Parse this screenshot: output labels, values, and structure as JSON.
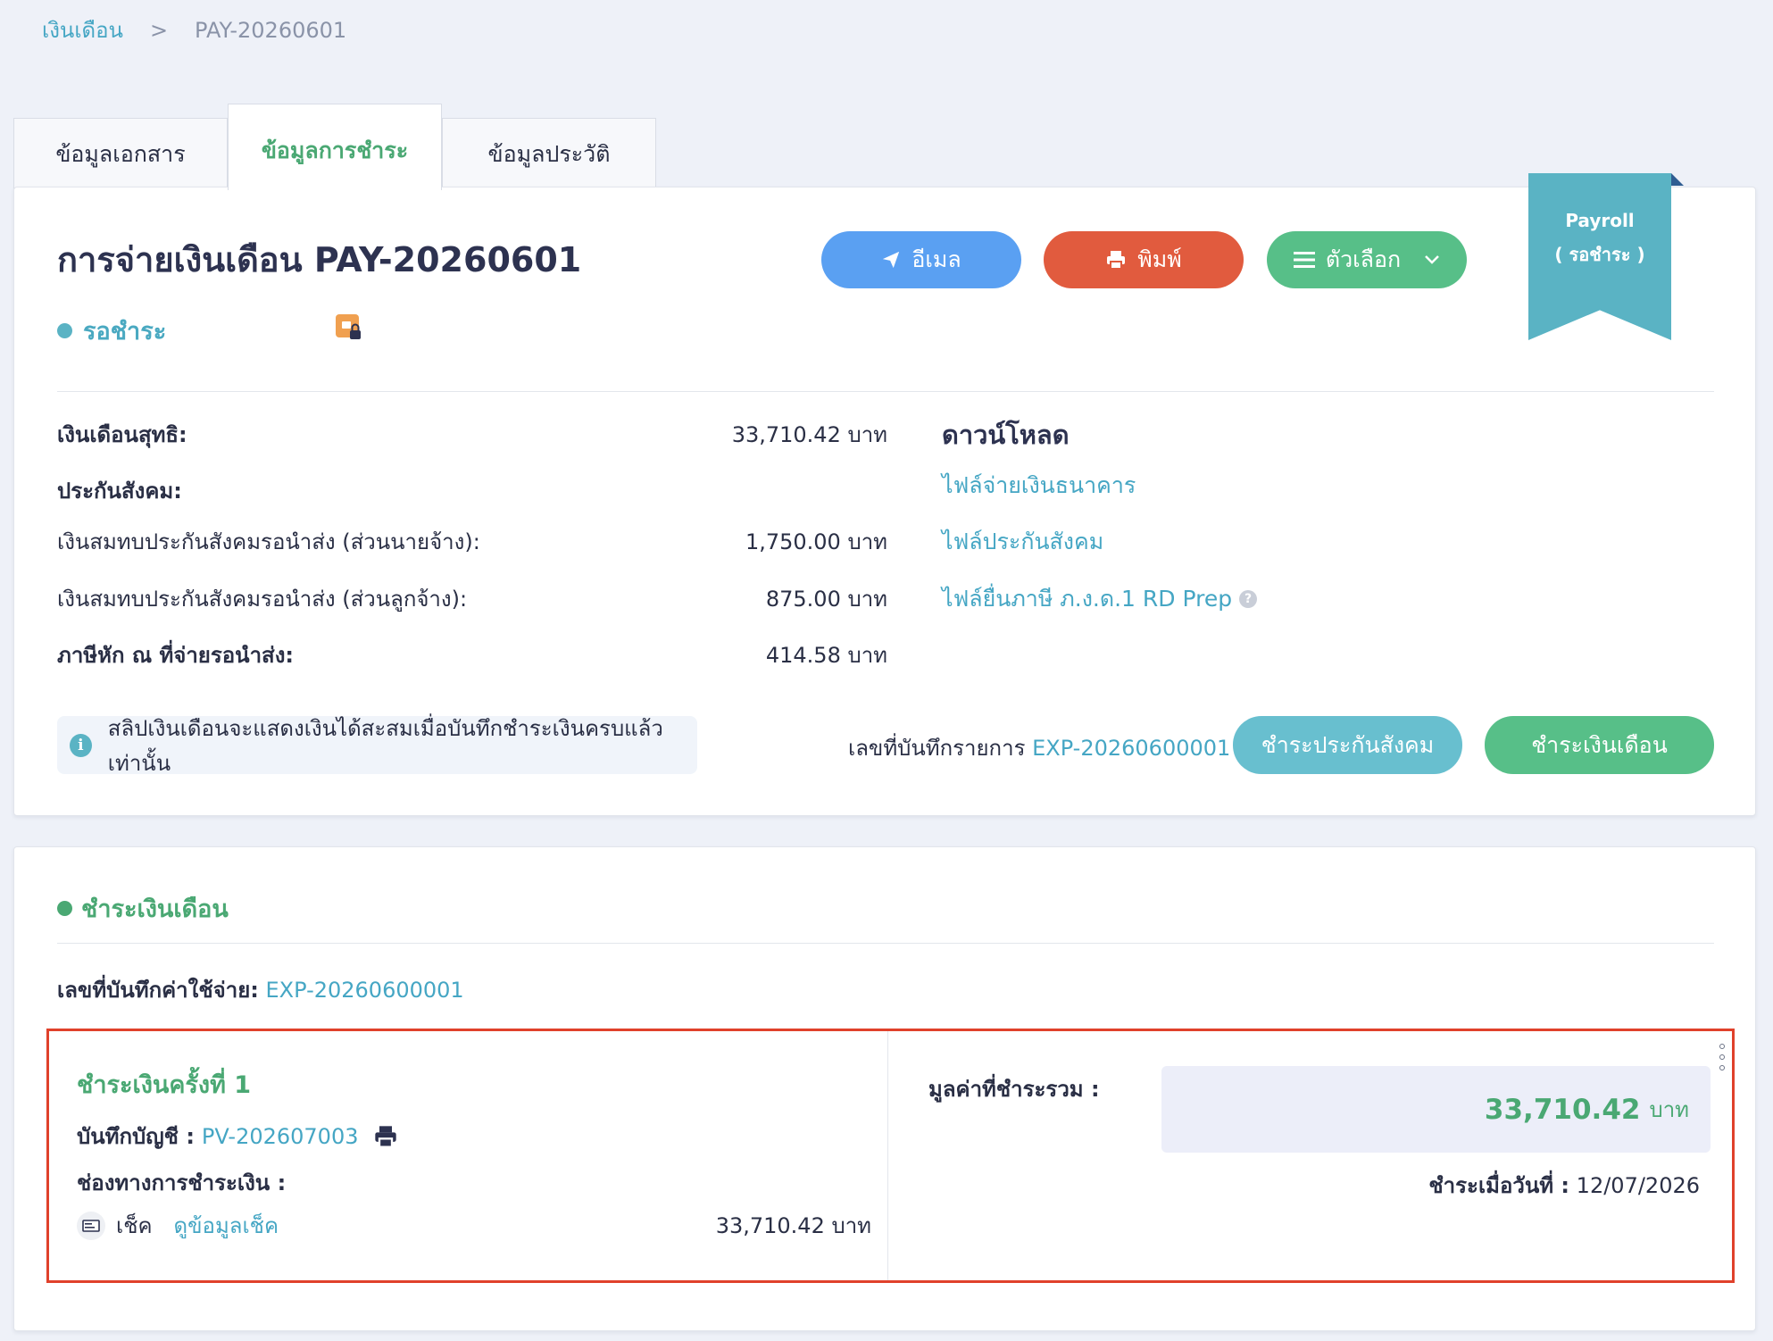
{
  "breadcrumb": {
    "parent": "เงินเดือน",
    "separator": ">",
    "current": "PAY-20260601"
  },
  "tabs": [
    {
      "label": "ข้อมูลเอกสาร"
    },
    {
      "label": "ข้อมูลการชำระ"
    },
    {
      "label": "ข้อมูลประวัติ"
    }
  ],
  "active_tab": "ข้อมูลการชำระ",
  "header": {
    "title": "การจ่ายเงินเดือน PAY-20260601",
    "status": "รอชำระ",
    "status_color": "#5ab3c4",
    "lock_icon": "locked-document-icon"
  },
  "actions": {
    "email_label": "อีเมล",
    "print_label": "พิมพ์",
    "options_label": "ตัวเลือก"
  },
  "ribbon": {
    "line1": "Payroll",
    "line2": "( รอชำระ )"
  },
  "summary": {
    "net_salary_label": "เงินเดือนสุทธิ:",
    "net_salary_value": "33,710.42 บาท",
    "social_security_label": "ประกันสังคม:",
    "ss_employer_label": "เงินสมทบประกันสังคมรอนำส่ง (ส่วนนายจ้าง):",
    "ss_employer_value": "1,750.00 บาท",
    "ss_employee_label": "เงินสมทบประกันสังคมรอนำส่ง (ส่วนลูกจ้าง):",
    "ss_employee_value": "875.00 บาท",
    "wht_label": "ภาษีหัก ณ ที่จ่ายรอนำส่ง:",
    "wht_value": "414.58 บาท"
  },
  "download": {
    "title": "ดาวน์โหลด",
    "bank_file": "ไฟล์จ่ายเงินธนาคาร",
    "ss_file": "ไฟล์ประกันสังคม",
    "tax_file": "ไฟล์ยื่นภาษี ภ.ง.ด.1 RD Prep",
    "help_symbol": "?"
  },
  "info": {
    "icon_symbol": "i",
    "text": "สลิปเงินเดือนจะแสดงเงินได้สะสมเมื่อบันทึกชำระเงินครบแล้วเท่านั้น"
  },
  "transaction": {
    "label": "เลขที่บันทึกรายการ",
    "number": "EXP-20260600001",
    "pay_ss_label": "ชำระประกันสังคม",
    "pay_salary_label": "ชำระเงินเดือน"
  },
  "payment_section": {
    "title": "ชำระเงินเดือน",
    "title_color": "#4aa873",
    "expense_label": "เลขที่บันทึกค่าใช้จ่าย:",
    "expense_number": "EXP-20260600001",
    "payment": {
      "title": "ชำระเงินครั้งที่ 1",
      "account_label": "บันทึกบัญชี :",
      "account_number": "PV-202607003",
      "channel_label": "ช่องทางการชำระเงิน :",
      "method_name": "เช็ค",
      "method_link": "ดูข้อมูลเช็ค",
      "method_amount": "33,710.42 บาท",
      "total_label": "มูลค่าที่ชำระรวม :",
      "total_value": "33,710.42",
      "total_unit": "บาท",
      "paid_date_label": "ชำระเมื่อวันที่ :",
      "paid_date": "12/07/2026"
    }
  },
  "colors": {
    "accent_green": "#57bf88",
    "accent_blue": "#5aa0f2",
    "accent_red": "#e15b3e",
    "link": "#45a6c4",
    "highlight_border": "#e0412b"
  }
}
